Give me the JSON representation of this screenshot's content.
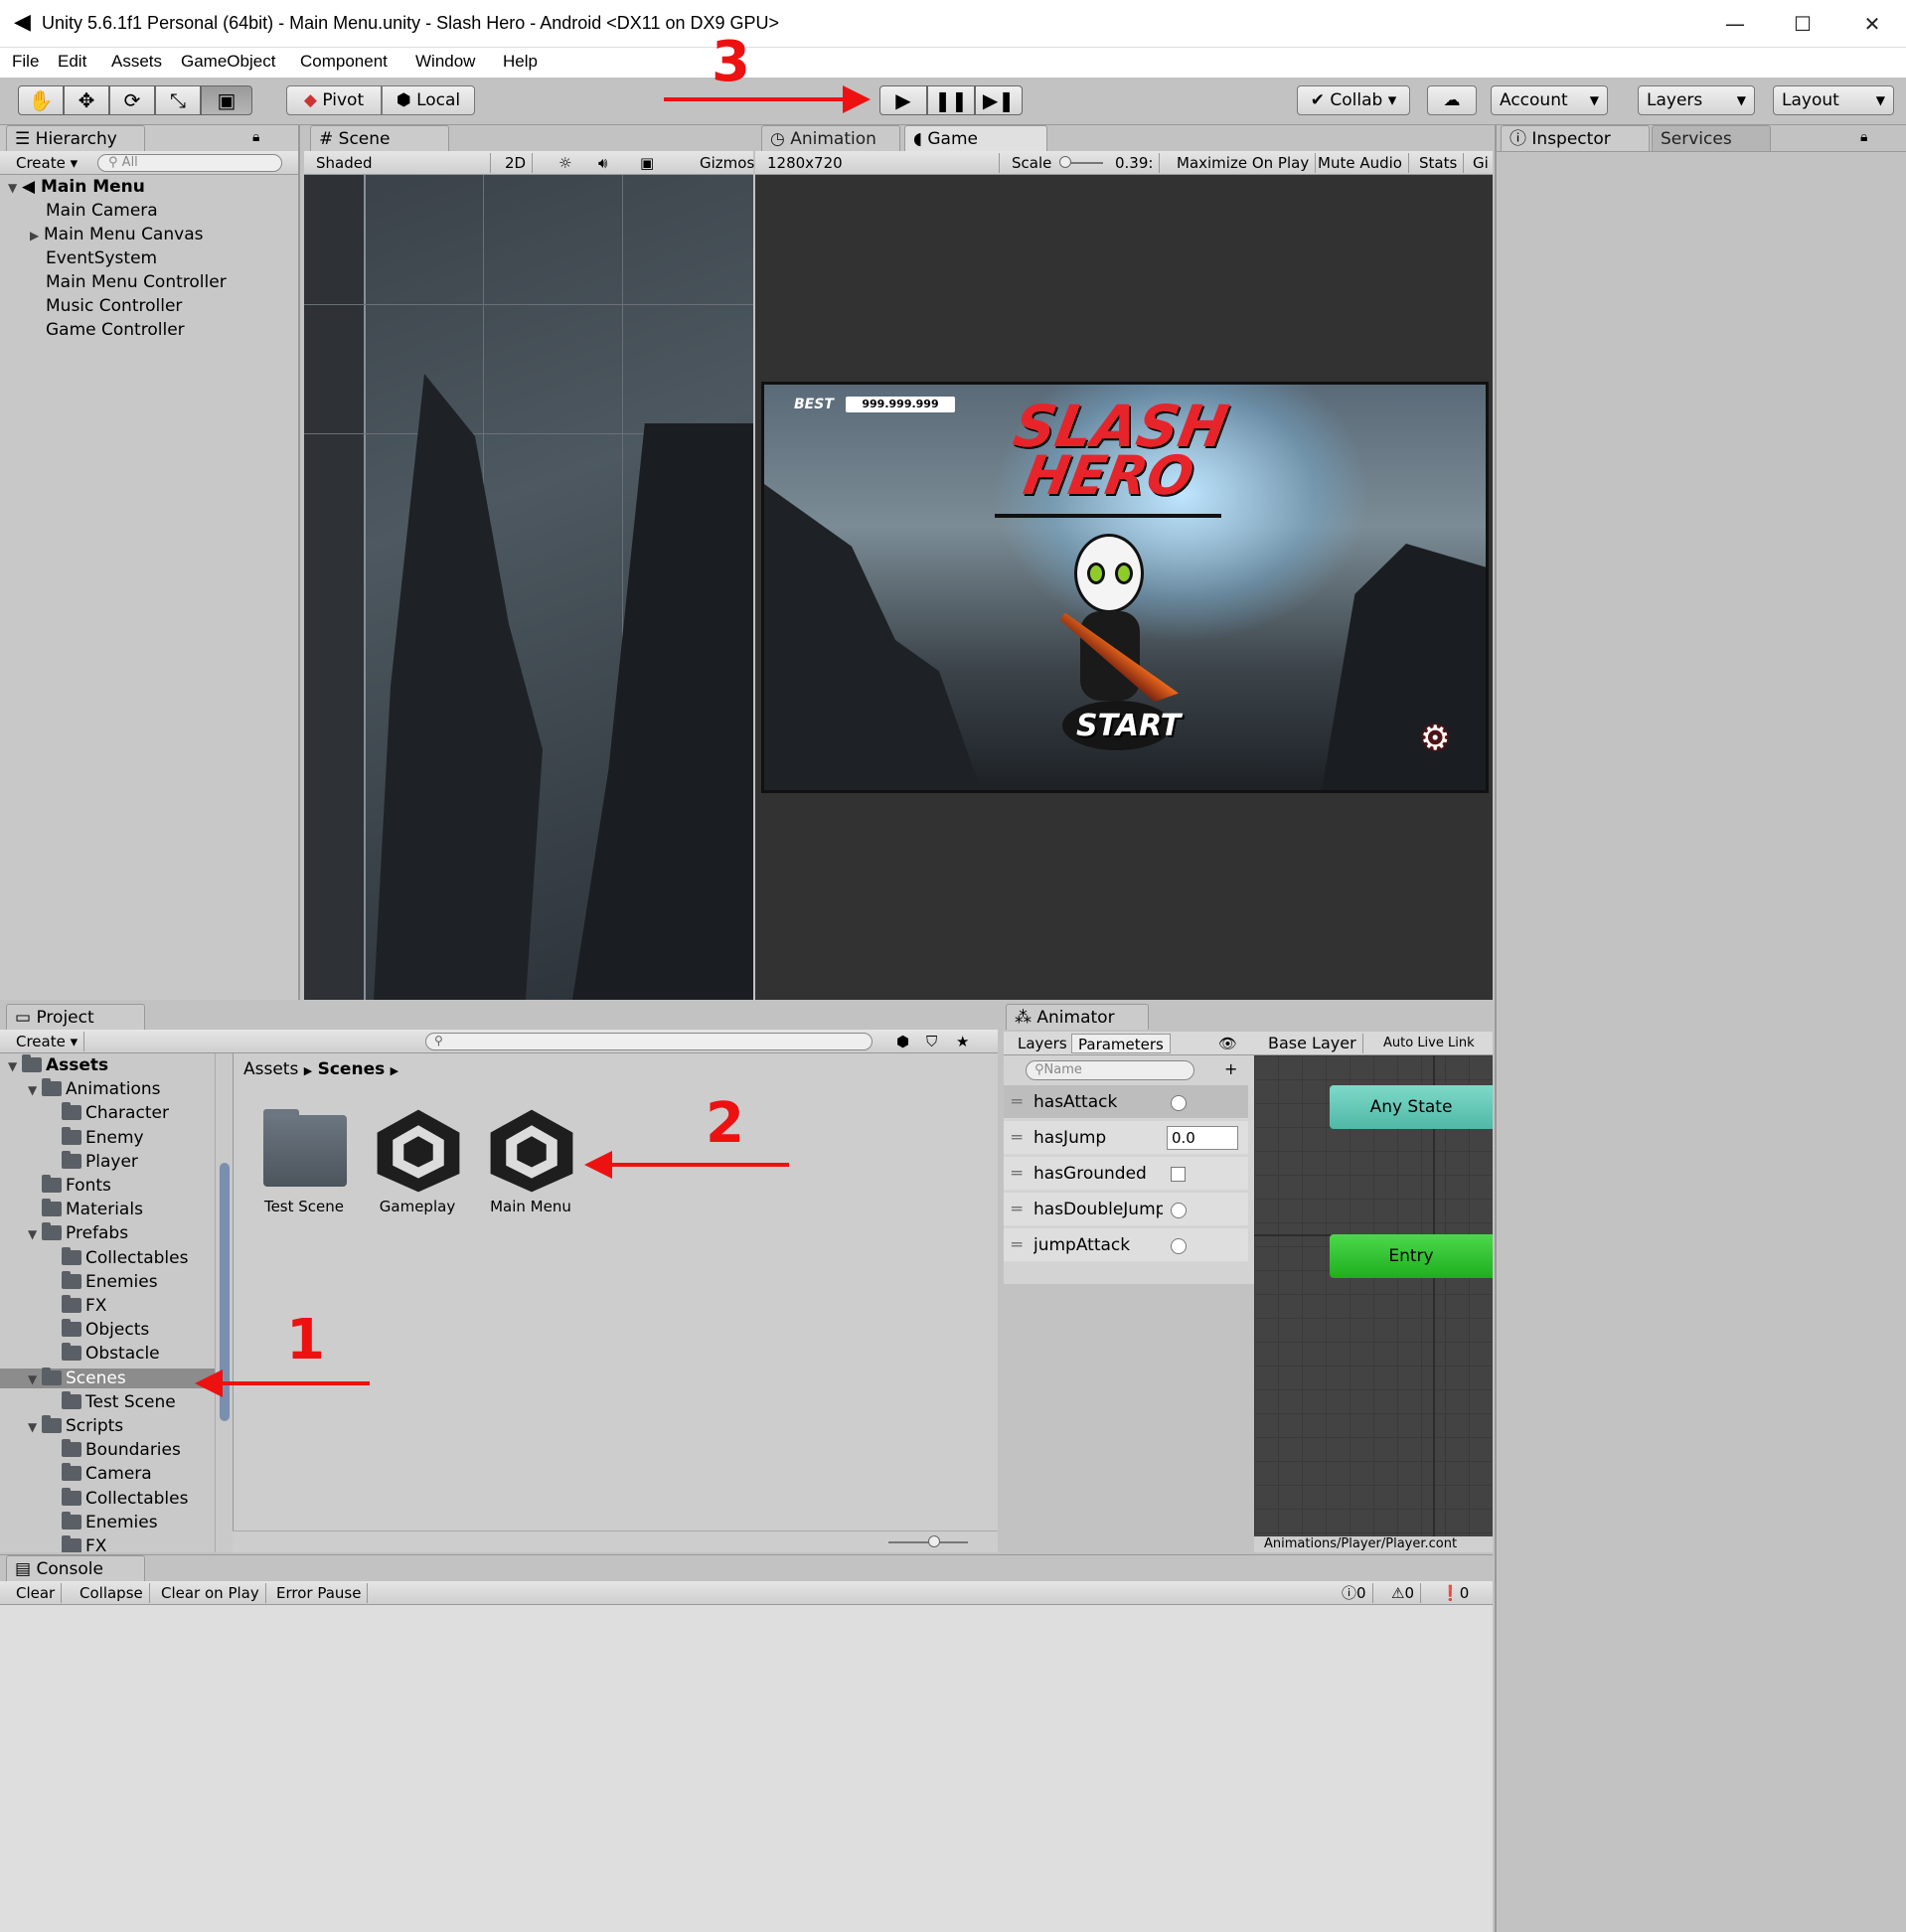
{
  "window": {
    "title": "Unity 5.6.1f1 Personal (64bit) - Main Menu.unity - Slash Hero - Android <DX11 on DX9 GPU>",
    "minimize": "—",
    "maximize": "☐",
    "close": "✕"
  },
  "menu": [
    "File",
    "Edit",
    "Assets",
    "GameObject",
    "Component",
    "Window",
    "Help"
  ],
  "toolbar": {
    "pivot": "Pivot",
    "local": "Local",
    "collab": "Collab ▾",
    "account": "Account",
    "layers": "Layers",
    "layout": "Layout"
  },
  "hierarchy": {
    "tab": "Hierarchy",
    "create": "Create ▾",
    "search_placeholder": "All",
    "scene": "Main Menu",
    "items": [
      "Main Camera",
      "Main Menu Canvas",
      "EventSystem",
      "Main Menu Controller",
      "Music Controller",
      "Game Controller"
    ]
  },
  "scene": {
    "tab": "Scene",
    "shaded": "Shaded",
    "mode2d": "2D",
    "gizmos": "Gizmos"
  },
  "game": {
    "tab_animation": "Animation",
    "tab_game": "Game",
    "resolution": "1280x720",
    "scale_label": "Scale",
    "scale_value": "0.39:",
    "maximize": "Maximize On Play",
    "mute": "Mute Audio",
    "stats": "Stats",
    "gizmos": "Gi",
    "best_label": "BEST",
    "best_value": "999.999.999",
    "logo_line1": "SLASH",
    "logo_line2": "HERO",
    "start": "START"
  },
  "inspector": {
    "tab": "Inspector",
    "services": "Services"
  },
  "project": {
    "tab": "Project",
    "create": "Create ▾",
    "breadcrumb_root": "Assets",
    "breadcrumb_current": "Scenes",
    "tree": [
      {
        "label": "Assets",
        "depth": 0,
        "open": true,
        "bold": true
      },
      {
        "label": "Animations",
        "depth": 1,
        "open": true
      },
      {
        "label": "Character",
        "depth": 2
      },
      {
        "label": "Enemy",
        "depth": 2
      },
      {
        "label": "Player",
        "depth": 2
      },
      {
        "label": "Fonts",
        "depth": 1
      },
      {
        "label": "Materials",
        "depth": 1
      },
      {
        "label": "Prefabs",
        "depth": 1,
        "open": true
      },
      {
        "label": "Collectables",
        "depth": 2
      },
      {
        "label": "Enemies",
        "depth": 2
      },
      {
        "label": "FX",
        "depth": 2
      },
      {
        "label": "Objects",
        "depth": 2
      },
      {
        "label": "Obstacle",
        "depth": 2
      },
      {
        "label": "Scenes",
        "depth": 1,
        "open": true,
        "selected": true
      },
      {
        "label": "Test Scene",
        "depth": 2
      },
      {
        "label": "Scripts",
        "depth": 1,
        "open": true
      },
      {
        "label": "Boundaries",
        "depth": 2
      },
      {
        "label": "Camera",
        "depth": 2
      },
      {
        "label": "Collectables",
        "depth": 2
      },
      {
        "label": "Enemies",
        "depth": 2
      },
      {
        "label": "FX",
        "depth": 2
      }
    ],
    "assets": [
      {
        "label": "Test Scene",
        "kind": "folder"
      },
      {
        "label": "Gameplay",
        "kind": "unity-scene"
      },
      {
        "label": "Main Menu",
        "kind": "unity-scene"
      }
    ]
  },
  "animator": {
    "tab": "Animator",
    "layers": "Layers",
    "parameters": "Parameters",
    "base_layer": "Base Layer",
    "auto_live": "Auto Live Link",
    "name_placeholder": "Name",
    "params": [
      {
        "name": "hasAttack",
        "type": "trigger"
      },
      {
        "name": "hasJump",
        "type": "float",
        "value": "0.0"
      },
      {
        "name": "hasGrounded",
        "type": "bool"
      },
      {
        "name": "hasDoubleJump",
        "type": "trigger"
      },
      {
        "name": "jumpAttack",
        "type": "trigger"
      }
    ],
    "any_state": "Any State",
    "entry": "Entry",
    "path": "Animations/Player/Player.cont"
  },
  "console": {
    "tab": "Console",
    "clear": "Clear",
    "collapse": "Collapse",
    "clear_on_play": "Clear on Play",
    "error_pause": "Error Pause",
    "log_count": "0",
    "warn_count": "0",
    "error_count": "0"
  },
  "annotations": {
    "step1": "1",
    "step2": "2",
    "step3": "3"
  },
  "colors": {
    "annotation": "#ee1111",
    "any_state": "#5ec8b8",
    "entry": "#2bc72b"
  }
}
